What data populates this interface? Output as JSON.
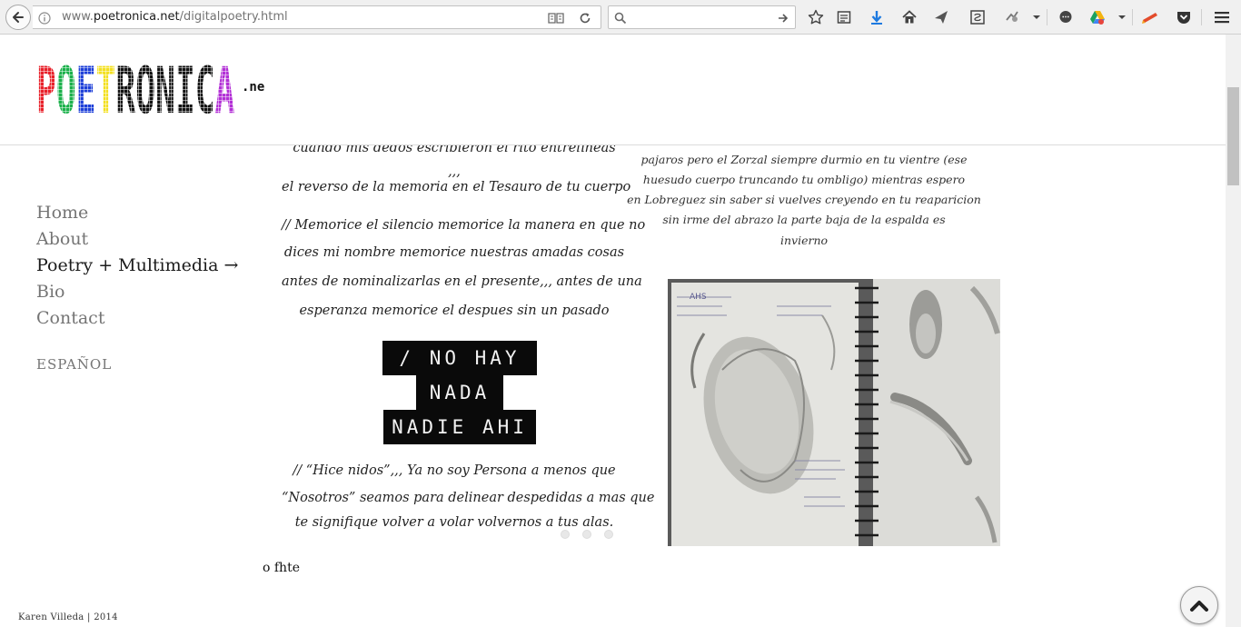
{
  "browser": {
    "url_prefix": "www.",
    "url_host": "poetronica.net",
    "url_path": "/digitalpoetry.html",
    "search_value": ""
  },
  "logo": {
    "main": "POETRONICA",
    "suffix": ".net"
  },
  "nav": {
    "items": [
      {
        "label": "Home",
        "active": false
      },
      {
        "label": "About",
        "active": false
      },
      {
        "label": "Poetry + Multimedia →",
        "active": true
      },
      {
        "label": "Bio",
        "active": false
      },
      {
        "label": "Contact",
        "active": false
      }
    ],
    "language": "ESPAÑOL"
  },
  "poem_left": {
    "lines": [
      "cuando mis dedos escribieron el rito entrelíneas",
      ",,,",
      "el reverso de la memoria en el Tesauro de tu cuerpo",
      "// Memorice el silencio memorice la manera en que no",
      "dices mi nombre memorice nuestras  amadas  cosas",
      "antes de nominalizarlas en el presente,,, antes de una",
      "esperanza memorice el  despues  sin un pasado"
    ],
    "block": [
      "/ NO HAY",
      "NADA",
      "NADIE AHI"
    ],
    "tail": [
      "// “Hice nidos”,,, Ya no soy Persona a menos que",
      "“Nosotros” seamos para delinear despedidas a mas que",
      "te signifique volver a volar volvernos a tus alas."
    ]
  },
  "poem_right": {
    "lines": [
      "pajaros pero el Zorzal siempre durmio en tu vientre (ese",
      "huesudo cuerpo truncando tu ombligo) mientras espero",
      "en Lobreguez sin saber si vuelves creyendo en tu reaparicion",
      "sin irme del abrazo la parte baja de la espalda es",
      "invierno"
    ]
  },
  "notebook": {
    "label": "AHS"
  },
  "caption": "o fhte",
  "footer": "Karen Villeda | 2014",
  "colors": {
    "nav_text": "#757575",
    "nav_active": "#1b1b1b",
    "logo_colors": [
      "#e8202a",
      "#1ab04a",
      "#1d3fd8",
      "#f3e020",
      "#111111",
      "#111111",
      "#111111",
      "#111111",
      "#111111",
      "#b22fd6"
    ]
  }
}
